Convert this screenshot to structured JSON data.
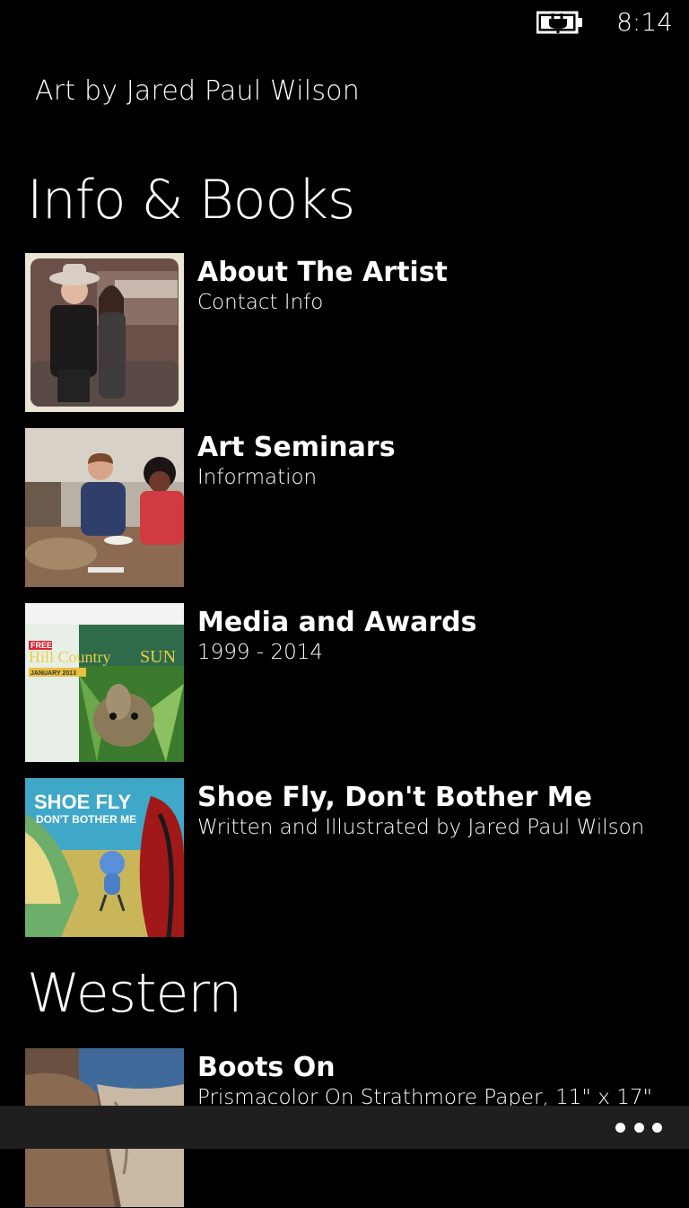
{
  "status_bar": {
    "time": "8:14",
    "battery_icon": "battery-charging-icon"
  },
  "app_title": "Art by Jared Paul Wilson",
  "sections": [
    {
      "header": "Info & Books",
      "items": [
        {
          "title": "About The Artist",
          "subtitle": "Contact Info",
          "thumbnail": "artist-photo"
        },
        {
          "title": "Art Seminars",
          "subtitle": "Information",
          "thumbnail": "seminar-photo"
        },
        {
          "title": "Media and Awards",
          "subtitle": "1999 - 2014",
          "thumbnail": "magazine-cover",
          "thumbnail_text": {
            "badge": "FREE",
            "masthead_a": "Hill Country",
            "masthead_b": "SUN",
            "date": "JANUARY 2013"
          }
        },
        {
          "title": "Shoe Fly, Don't Bother Me",
          "subtitle": "Written and Illustrated by Jared Paul Wilson",
          "thumbnail": "book-cover",
          "thumbnail_text": {
            "line1": "SHOE FLY",
            "line2": "DON'T BOTHER ME"
          }
        }
      ]
    },
    {
      "header": "Western",
      "items": [
        {
          "title": "Boots On",
          "subtitle": "Prismacolor On Strathmore Paper, 11\" x 17\"",
          "thumbnail": "boots-artwork"
        }
      ]
    }
  ],
  "app_bar": {
    "more_icon": "ellipsis-icon"
  }
}
